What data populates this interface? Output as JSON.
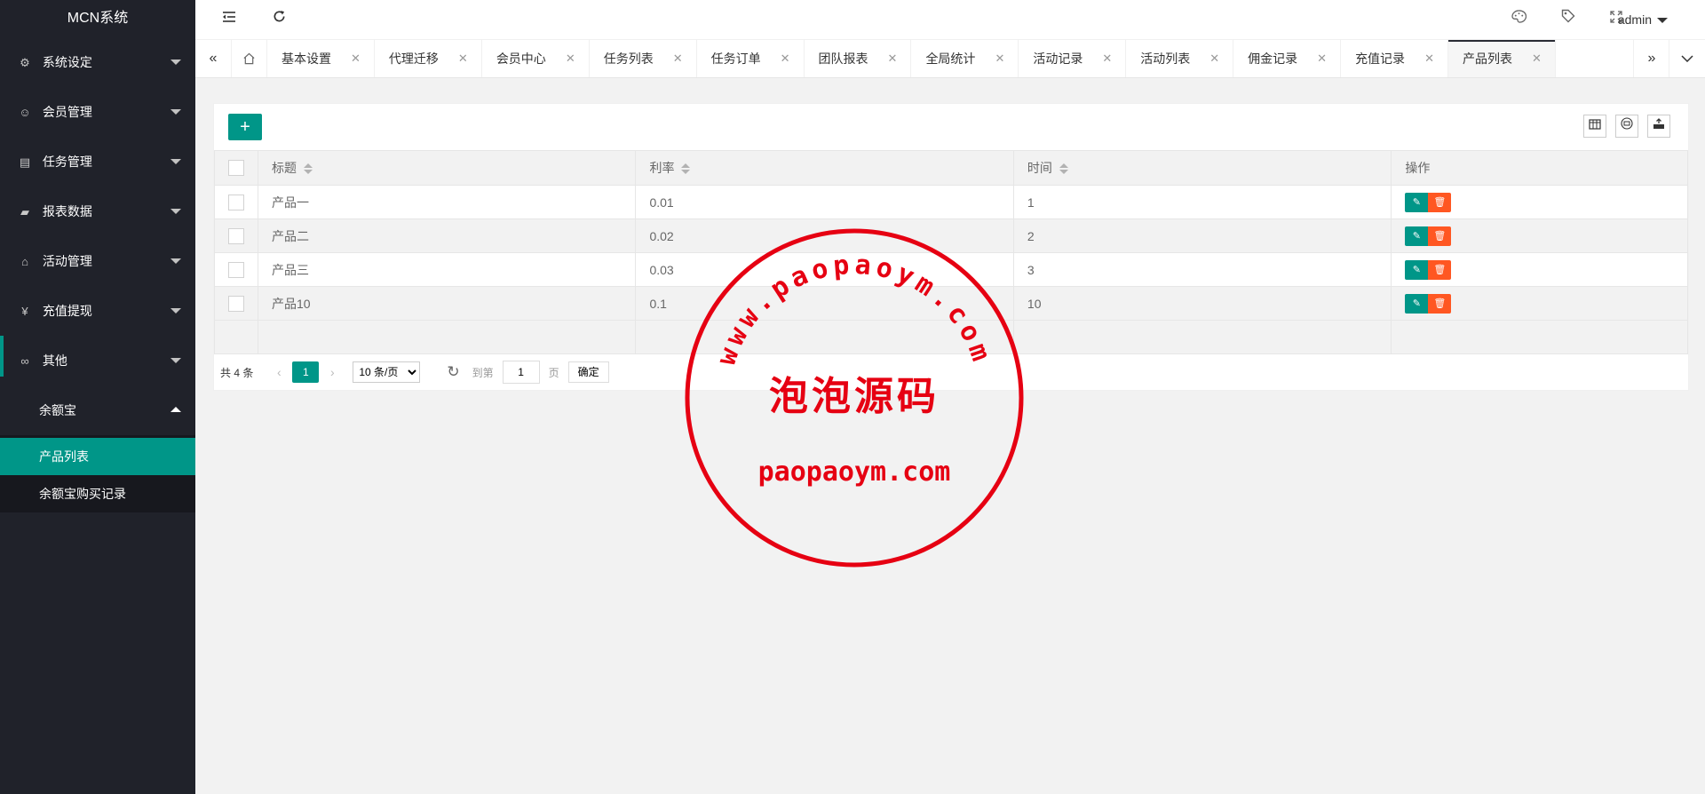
{
  "app": {
    "title": "MCN系统"
  },
  "sidebar": {
    "items": [
      {
        "label": "系统设定",
        "icon": "gear-icon",
        "glyph": "⚙"
      },
      {
        "label": "会员管理",
        "icon": "user-icon",
        "glyph": "☺"
      },
      {
        "label": "任务管理",
        "icon": "document-icon",
        "glyph": "▤"
      },
      {
        "label": "报表数据",
        "icon": "report-icon",
        "glyph": "▰"
      },
      {
        "label": "活动管理",
        "icon": "bank-icon",
        "glyph": "⌂"
      },
      {
        "label": "充值提现",
        "icon": "yen-icon",
        "glyph": "¥"
      },
      {
        "label": "其他",
        "icon": "link-icon",
        "glyph": "∞"
      },
      {
        "label": "余额宝",
        "icon": "",
        "glyph": ""
      }
    ],
    "submenu": [
      {
        "label": "产品列表",
        "active": true
      },
      {
        "label": "余额宝购买记录",
        "active": false
      }
    ]
  },
  "header": {
    "user": "admin",
    "icons": [
      "menu-fold-icon",
      "refresh-icon",
      "theme-icon",
      "tag-icon",
      "fullscreen-icon"
    ]
  },
  "tabs": {
    "items": [
      {
        "label": "基本设置"
      },
      {
        "label": "代理迁移"
      },
      {
        "label": "会员中心"
      },
      {
        "label": "任务列表"
      },
      {
        "label": "任务订单"
      },
      {
        "label": "团队报表"
      },
      {
        "label": "全局统计"
      },
      {
        "label": "活动记录"
      },
      {
        "label": "活动列表"
      },
      {
        "label": "佣金记录"
      },
      {
        "label": "充值记录"
      },
      {
        "label": "产品列表",
        "active": true
      }
    ]
  },
  "table": {
    "columns": [
      "标题",
      "利率",
      "时间",
      "操作"
    ],
    "rows": [
      [
        "产品一",
        "0.01",
        "1"
      ],
      [
        "产品二",
        "0.02",
        "2"
      ],
      [
        "产品三",
        "0.03",
        "3"
      ],
      [
        "产品10",
        "0.1",
        "10"
      ]
    ]
  },
  "pager": {
    "total": "共 4 条",
    "current_page": "1",
    "page_size": "10 条/页",
    "goto_label": "到第",
    "goto_value": "1",
    "page_suffix": "页",
    "confirm": "确定"
  },
  "watermark": {
    "url_arc": "www.paopaoym.com",
    "name": "泡泡源码",
    "domain": "paopaoym.com",
    "color": "#e60012"
  },
  "colors": {
    "sidebar_bg": "#20222a",
    "accent": "#009688",
    "danger": "#ff5722"
  }
}
